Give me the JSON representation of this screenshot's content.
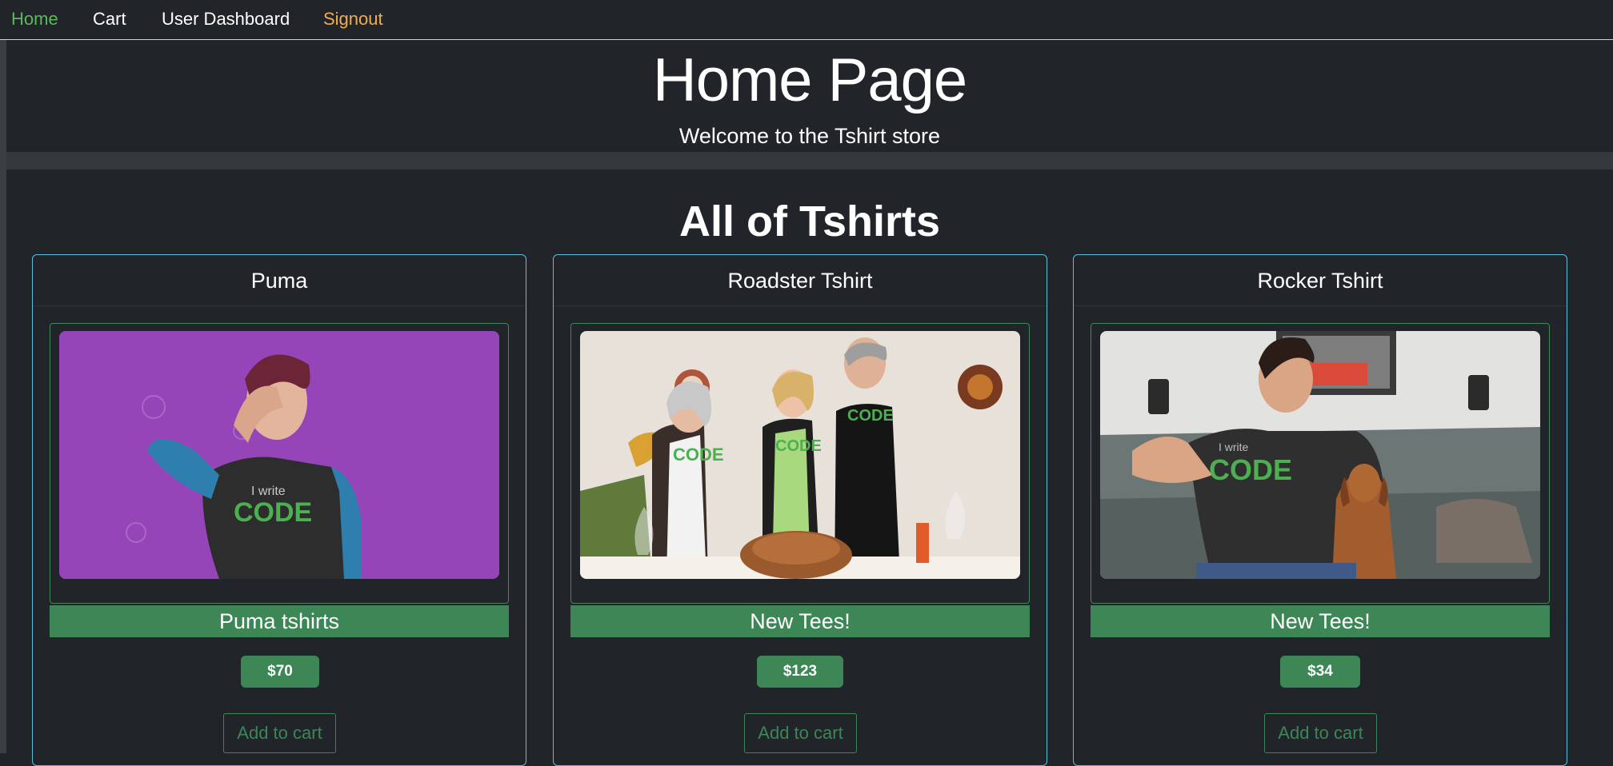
{
  "nav": {
    "items": [
      {
        "label": "Home"
      },
      {
        "label": "Cart"
      },
      {
        "label": "User Dashboard"
      },
      {
        "label": "Signout"
      }
    ]
  },
  "header": {
    "title": "Home Page",
    "subtitle": "Welcome to the Tshirt store"
  },
  "section": {
    "title": "All of Tshirts"
  },
  "products": [
    {
      "name": "Puma",
      "description": "Puma tshirts",
      "price": "$70",
      "button": "Add to cart",
      "image": "woman-purple-code-tshirt-photo"
    },
    {
      "name": "Roadster Tshirt",
      "description": "New Tees!",
      "price": "$123",
      "button": "Add to cart",
      "image": "family-dinner-code-tshirts-photo"
    },
    {
      "name": "Rocker Tshirt",
      "description": "New Tees!",
      "price": "$34",
      "button": "Add to cart",
      "image": "man-dog-sofa-code-tshirt-photo"
    }
  ],
  "colors": {
    "background": "#212529",
    "active_nav": "#5cb85c",
    "signout": "#f0ad4e",
    "success": "#3d8656",
    "card_border": "#5bc0de"
  }
}
